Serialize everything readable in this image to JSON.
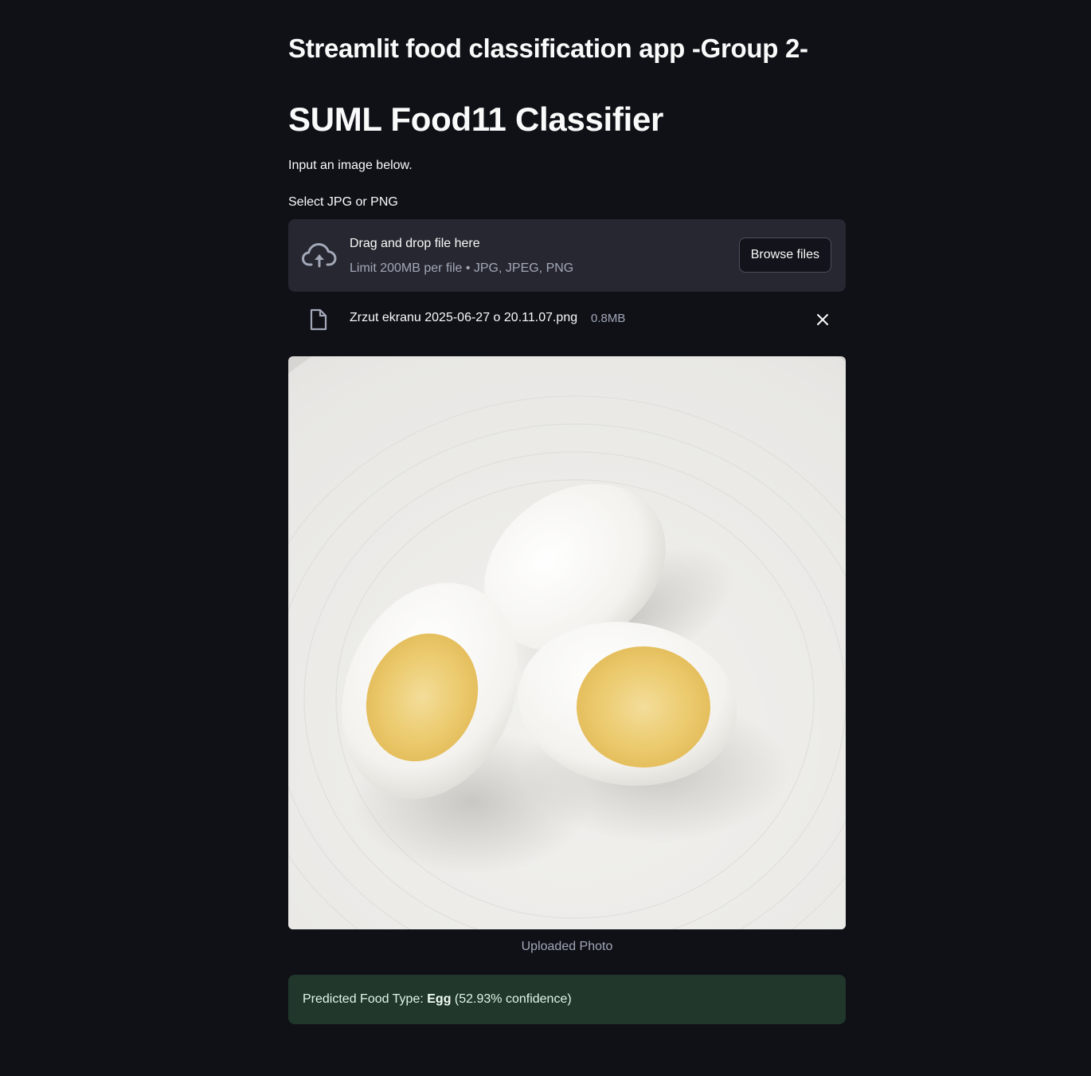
{
  "header": {
    "app_title": "Streamlit food classification app -Group 2-",
    "page_title": "SUML Food11 Classifier",
    "intro": "Input an image below."
  },
  "uploader": {
    "label": "Select JPG or PNG",
    "dropzone_title": "Drag and drop file here",
    "dropzone_limit": "Limit 200MB per file • JPG, JPEG, PNG",
    "browse_label": "Browse files"
  },
  "uploaded_file": {
    "name": "Zrzut ekranu 2025-06-27 o 20.11.07.png",
    "size": "0.8MB"
  },
  "image": {
    "caption": "Uploaded Photo"
  },
  "result": {
    "prefix": "Predicted Food Type: ",
    "label": "Egg",
    "confidence": "(52.93% confidence)"
  },
  "colors": {
    "background": "#0f1117",
    "dropzone": "#262730",
    "success_bg": "#21372b"
  }
}
